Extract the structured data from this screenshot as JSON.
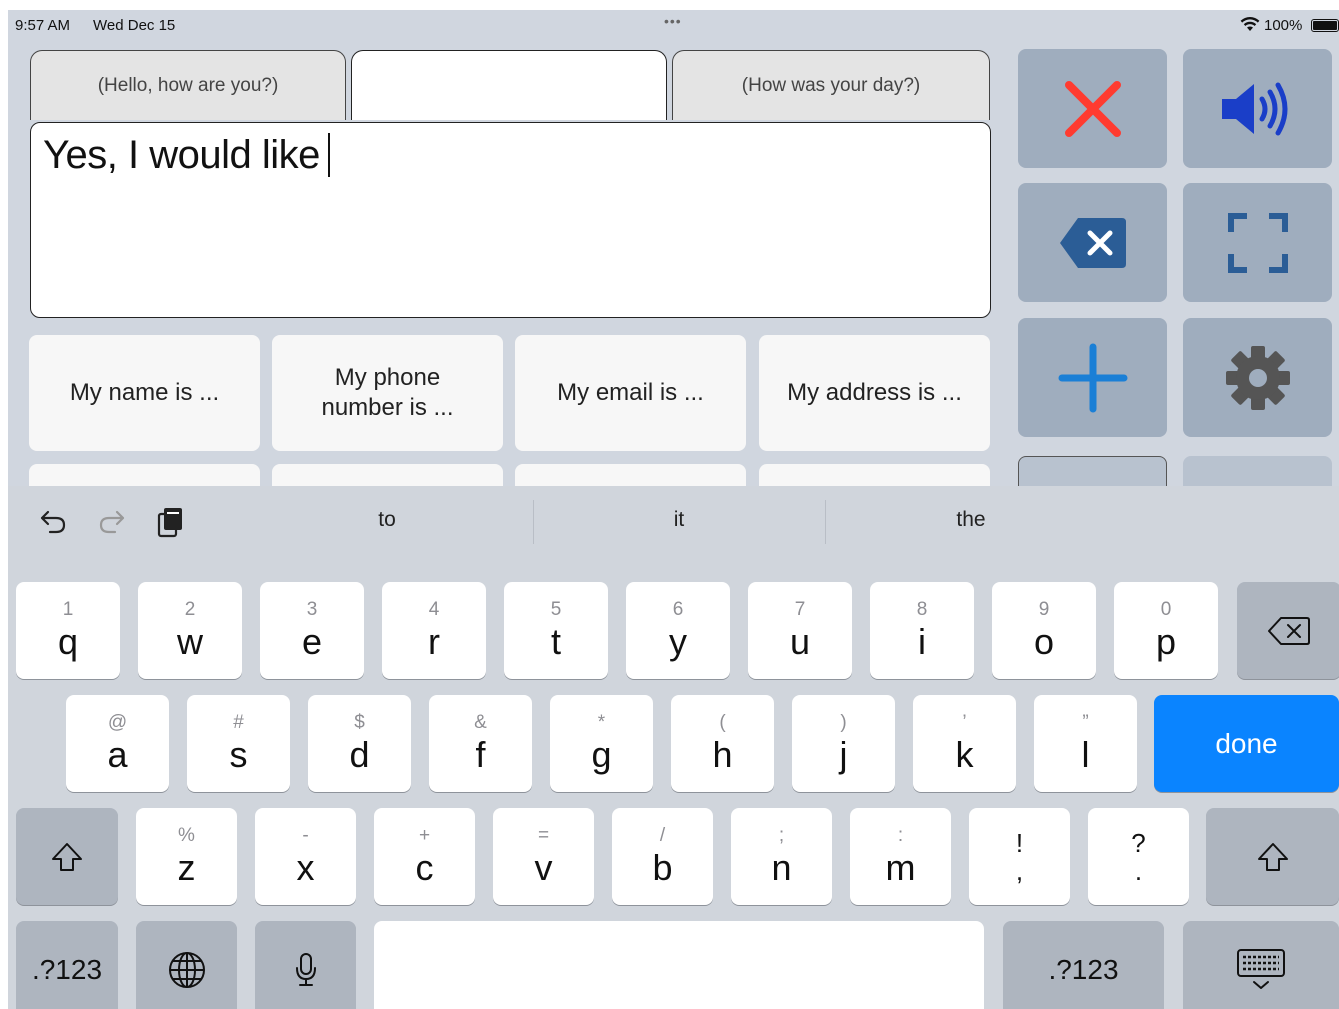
{
  "status_bar": {
    "time": "9:57 AM",
    "date": "Wed Dec 15",
    "dots": "•••",
    "battery": "100%"
  },
  "history": {
    "tabs": [
      "(Hello, how are you?)",
      "",
      "(How was your day?)"
    ]
  },
  "compose": {
    "text": "Yes, I would like"
  },
  "phrases": [
    "My name is ...",
    "My phone number is ...",
    "My email is ...",
    "My address is ..."
  ],
  "actions": [
    {
      "name": "clear",
      "icon": "close-icon",
      "color": "#ff3b30"
    },
    {
      "name": "speak",
      "icon": "speaker-icon",
      "color": "#1a3ec8"
    },
    {
      "name": "delete",
      "icon": "delete-backward-icon",
      "color": "#2b5d96"
    },
    {
      "name": "fullscreen",
      "icon": "fullscreen-icon",
      "color": "#2b5d96"
    },
    {
      "name": "add",
      "icon": "plus-icon",
      "color": "#1a7fd6"
    },
    {
      "name": "settings",
      "icon": "gear-icon",
      "color": "#555555"
    }
  ],
  "keyboard": {
    "suggestions": [
      "to",
      "it",
      "the"
    ],
    "row1": [
      {
        "alt": "1",
        "key": "q"
      },
      {
        "alt": "2",
        "key": "w"
      },
      {
        "alt": "3",
        "key": "e"
      },
      {
        "alt": "4",
        "key": "r"
      },
      {
        "alt": "5",
        "key": "t"
      },
      {
        "alt": "6",
        "key": "y"
      },
      {
        "alt": "7",
        "key": "u"
      },
      {
        "alt": "8",
        "key": "i"
      },
      {
        "alt": "9",
        "key": "o"
      },
      {
        "alt": "0",
        "key": "p"
      }
    ],
    "row2": [
      {
        "alt": "@",
        "key": "a"
      },
      {
        "alt": "#",
        "key": "s"
      },
      {
        "alt": "$",
        "key": "d"
      },
      {
        "alt": "&",
        "key": "f"
      },
      {
        "alt": "*",
        "key": "g"
      },
      {
        "alt": "(",
        "key": "h"
      },
      {
        "alt": ")",
        "key": "j"
      },
      {
        "alt": "’",
        "key": "k"
      },
      {
        "alt": "”",
        "key": "l"
      }
    ],
    "row3": [
      {
        "alt": "%",
        "key": "z"
      },
      {
        "alt": "-",
        "key": "x"
      },
      {
        "alt": "+",
        "key": "c"
      },
      {
        "alt": "=",
        "key": "v"
      },
      {
        "alt": "/",
        "key": "b"
      },
      {
        "alt": ";",
        "key": "n"
      },
      {
        "alt": ":",
        "key": "m"
      }
    ],
    "punct1": {
      "top": "!",
      "bottom": ","
    },
    "punct2": {
      "top": "?",
      "bottom": "."
    },
    "done_label": "done",
    "numbers_label": ".?123",
    "accent": "#0a84ff"
  }
}
